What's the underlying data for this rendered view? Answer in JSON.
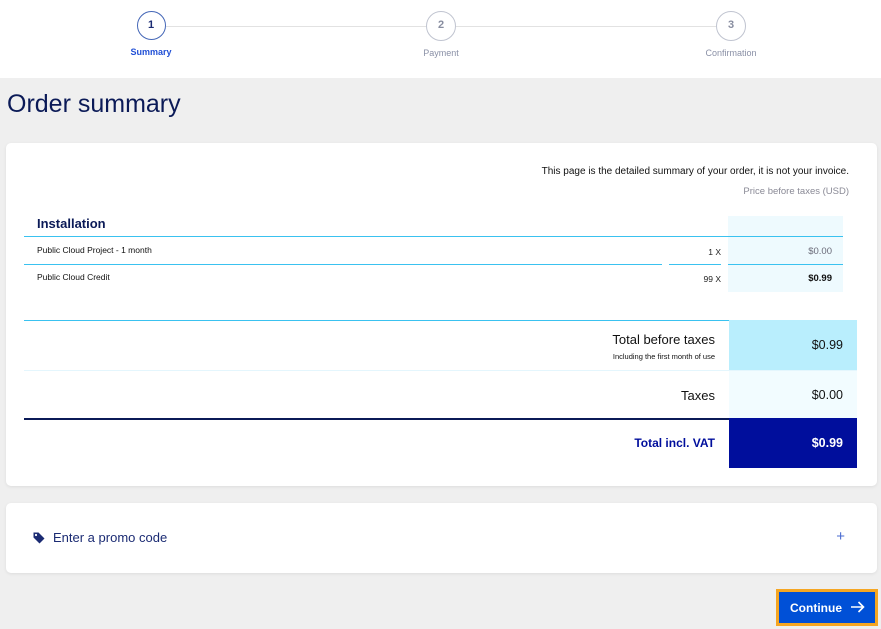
{
  "stepper": {
    "steps": [
      {
        "number": "1",
        "label": "Summary",
        "state": "active"
      },
      {
        "number": "2",
        "label": "Payment",
        "state": "pending"
      },
      {
        "number": "3",
        "label": "Confirmation",
        "state": "pending"
      }
    ]
  },
  "page": {
    "title": "Order summary"
  },
  "summary": {
    "note": "This page is the detailed summary of your order, it is not your invoice.",
    "price_note": "Price before taxes (USD)",
    "section_title": "Installation",
    "items": [
      {
        "label": "Public Cloud Project - 1 month",
        "quantity": "1 X",
        "price": "$0.00"
      },
      {
        "label": "Public Cloud Credit",
        "quantity": "99 X",
        "price": "$0.99"
      }
    ],
    "totals": {
      "before_taxes_label": "Total before taxes",
      "before_taxes_sub": "Including the first month of use",
      "before_taxes_value": "$0.99",
      "taxes_label": "Taxes",
      "taxes_value": "$0.00",
      "incl_vat_label": "Total incl. VAT",
      "incl_vat_value": "$0.99"
    }
  },
  "promo": {
    "label": "Enter a promo code",
    "expand_icon": "+"
  },
  "actions": {
    "continue_label": "Continue"
  },
  "colors": {
    "brand_dark": "#000e9c",
    "accent_light": "#b9eefd",
    "button": "#0050d7",
    "focus_outline": "#f5a623"
  }
}
